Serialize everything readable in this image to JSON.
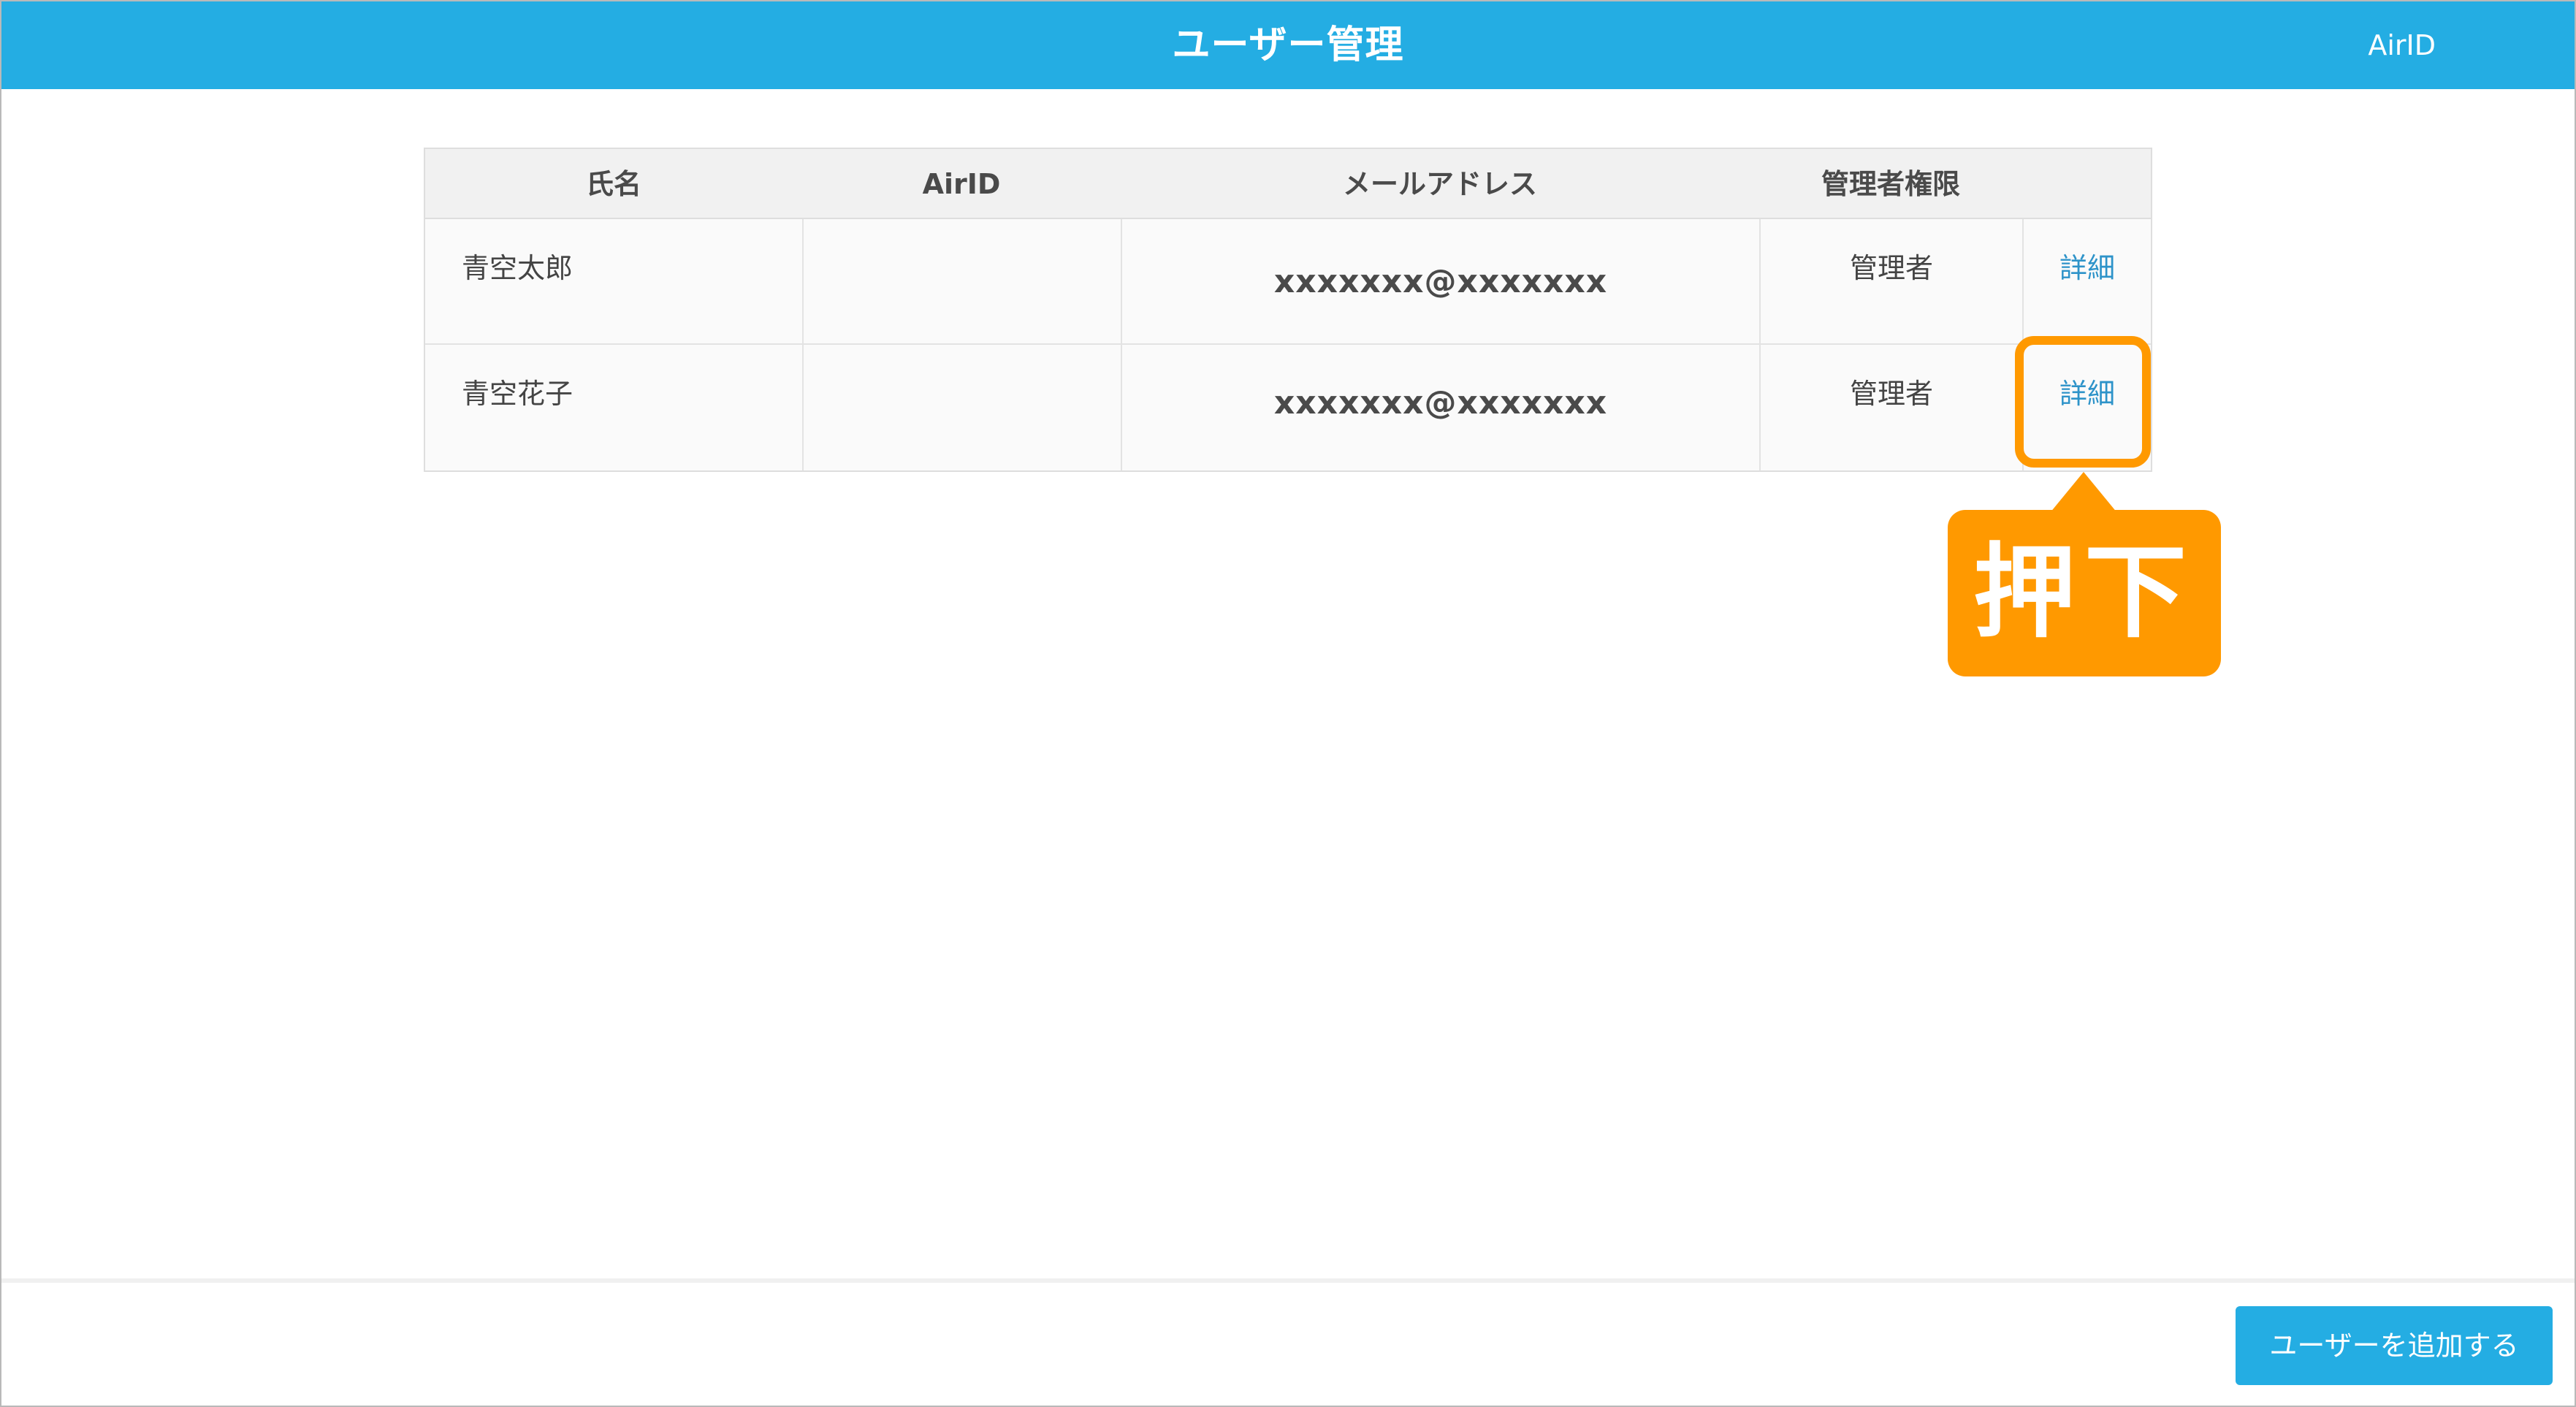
{
  "header": {
    "title": "ユーザー管理",
    "account_link": "AirID"
  },
  "table": {
    "columns": [
      "氏名",
      "AirID",
      "メールアドレス",
      "管理者権限",
      ""
    ],
    "rows": [
      {
        "name": "青空太郎",
        "airid": "",
        "email": "xxxxxxx@xxxxxxx",
        "role": "管理者",
        "action": "詳細"
      },
      {
        "name": "青空花子",
        "airid": "",
        "email": "xxxxxxx@xxxxxxx",
        "role": "管理者",
        "action": "詳細"
      }
    ]
  },
  "annotation": {
    "callout_text": "押下",
    "color": "#ff9900"
  },
  "footer": {
    "add_button_label": "ユーザーを追加する"
  },
  "colors": {
    "header_bg": "#24ade3",
    "link": "#2d93c9",
    "button_bg": "#24ade3"
  }
}
